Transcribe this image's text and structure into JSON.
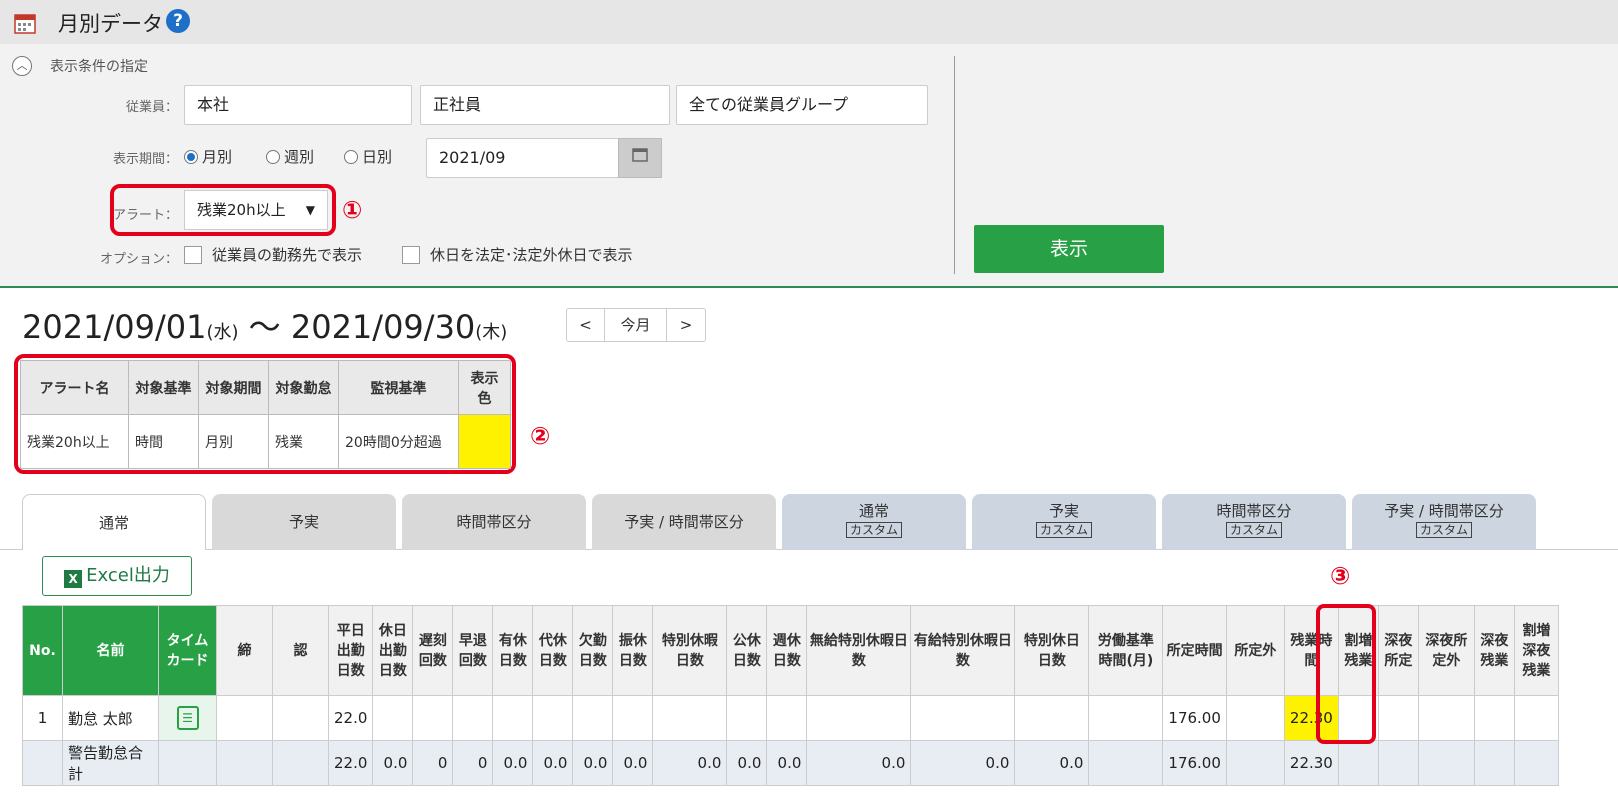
{
  "header": {
    "title": "月別データ",
    "help_glyph": "?"
  },
  "conditions": {
    "section_title": "表示条件の指定",
    "employee_label": "従業員：",
    "employee_values": [
      "本社",
      "正社員",
      "全ての従業員グループ"
    ],
    "period_label": "表示期間：",
    "period_options": [
      "月別",
      "週別",
      "日別"
    ],
    "period_selected": "月別",
    "month_value": "2021/09",
    "alert_label": "アラート：",
    "alert_value": "残業20h以上",
    "option_label": "オプション：",
    "options": [
      "従業員の勤務先で表示",
      "休日を法定･法定外休日で表示"
    ],
    "show_button": "表示"
  },
  "markers": [
    "①",
    "②",
    "③"
  ],
  "date_range": {
    "start": "2021/09/01",
    "start_day": "(水)",
    "sep": "〜",
    "end": "2021/09/30",
    "end_day": "(木)",
    "today_label": "今月",
    "prev": "<",
    "next": ">"
  },
  "alert_table": {
    "headers": [
      "アラート名",
      "対象基準",
      "対象期間",
      "対象勤怠",
      "監視基準",
      "表示色"
    ],
    "row": [
      "残業20h以上",
      "時間",
      "月別",
      "残業",
      "20時間0分超過",
      ""
    ],
    "color": "#fff200"
  },
  "tabs": [
    {
      "label": "通常",
      "sub": ""
    },
    {
      "label": "予実",
      "sub": ""
    },
    {
      "label": "時間帯区分",
      "sub": ""
    },
    {
      "label": "予実 / 時間帯区分",
      "sub": ""
    },
    {
      "label": "通常",
      "sub": "カスタム"
    },
    {
      "label": "予実",
      "sub": "カスタム"
    },
    {
      "label": "時間帯区分",
      "sub": "カスタム"
    },
    {
      "label": "予実 / 時間帯区分",
      "sub": "カスタム"
    }
  ],
  "excel_button": "Excel出力",
  "grid": {
    "headers": [
      "No.",
      "名前",
      "タイムカード",
      "締",
      "認",
      "平日出勤日数",
      "休日出勤日数",
      "遅刻回数",
      "早退回数",
      "有休日数",
      "代休日数",
      "欠勤日数",
      "振休日数",
      "特別休暇日数",
      "公休日数",
      "週休日数",
      "無給特別休暇日数",
      "有給特別休暇日数",
      "特別休日日数",
      "労働基準時間(月)",
      "所定時間",
      "所定外",
      "残業時間",
      "割増残業",
      "深夜所定",
      "深夜所定外",
      "深夜残業",
      "割増深夜残業"
    ],
    "rows": [
      [
        "1",
        "勤怠 太郎",
        "",
        "",
        "",
        "22.0",
        "",
        "",
        "",
        "",
        "",
        "",
        "",
        "",
        "",
        "",
        "",
        "",
        "",
        "",
        "176.00",
        "",
        "22.30",
        "",
        "",
        "",
        "",
        ""
      ],
      [
        "",
        "警告勤怠合計",
        "",
        "",
        "",
        "22.0",
        "0.0",
        "0",
        "0",
        "0.0",
        "0.0",
        "0.0",
        "0.0",
        "0.0",
        "0.0",
        "0.0",
        "0.0",
        "0.0",
        "0.0",
        "",
        "176.00",
        "",
        "22.30",
        "",
        "",
        "",
        "",
        ""
      ]
    ]
  }
}
